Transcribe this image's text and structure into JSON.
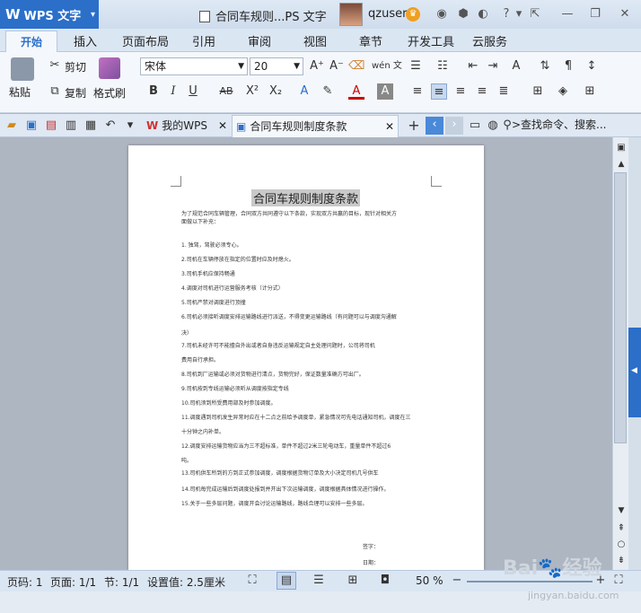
{
  "app": {
    "name": "WPS 文字",
    "doc_window_title": "合同车规则...PS 文字",
    "user": "qzuser"
  },
  "menu_tabs": [
    "开始",
    "插入",
    "页面布局",
    "引用",
    "审阅",
    "视图",
    "章节",
    "开发工具",
    "云服务"
  ],
  "ribbon": {
    "paste": "粘贴",
    "cut": "剪切",
    "copy": "复制",
    "format_painter": "格式刷",
    "font": "宋体",
    "size": "20",
    "wen": "wén 文"
  },
  "doc_tabs": {
    "my_wps": "我的WPS",
    "doc": "合同车规则制度条款"
  },
  "search": ">查找命令、搜索...",
  "doc": {
    "heading": "合同车规则制度条款",
    "lines": [
      "为了规范合同车辆管理，合同双方共同遵守以下条款，实现双方共赢的目标，现针对相关方",
      "面做以下补充：",
      "1. 独驾，驾驶必须专心。",
      "2.司机在车辆停放在指定的位置时应及时熄火。",
      "3.司机手机应保持畅通",
      "4.调度对司机进行运营服务考核（计分式）",
      "5.司机严禁对调度进行顶撞",
      "6.司机必须接听调度安排运输路线进行派送，不得变更运输路线（有问题可以与调度沟通解",
      "决）",
      "7.司机未经许可不能擅自外出或者自身违反运输规定自主处理问题时，公司将司机",
      "费用自行承担。",
      "8.司机到厂运输或必须对货物进行清点，货物完好，保证数量准确方可出厂。",
      "9.司机按到专线运输必须听从调度按指定专线",
      "10.司机须到所受费用部及时参加调度。",
      "11.调度遇到司机发生异常时应在十二点之前给予调度单，紧急情况可先电话通知司机，调度在三",
      "十分钟之内补单。",
      "12.调度安排运输货物应当为三不超标准，单件不超过2米三轮电动车，重量单件不超过6",
      "吨。",
      "13.司机供车所到的方到正式参加调度，调度根据货物订单及大小决定司机几号供车",
      "14.司机每完成运输后到调度处报到并开出下次运输调度，调度根据具体情况进行操作。",
      "15.关于一些多层问题，调度开会讨论运输路线，路线合理可以安排一些多层。"
    ],
    "sign": "签字：",
    "date": "日期："
  },
  "status": {
    "page_num": "页码: 1",
    "pages": "页面: 1/1",
    "section": "节: 1/1",
    "setting": "设置值: 2.5厘米",
    "zoom": "50 %"
  },
  "watermark": {
    "main": "Bai🐾经验",
    "sub": "jingyan.baidu.com"
  },
  "colors": {
    "accent": "#2b6fc9"
  }
}
